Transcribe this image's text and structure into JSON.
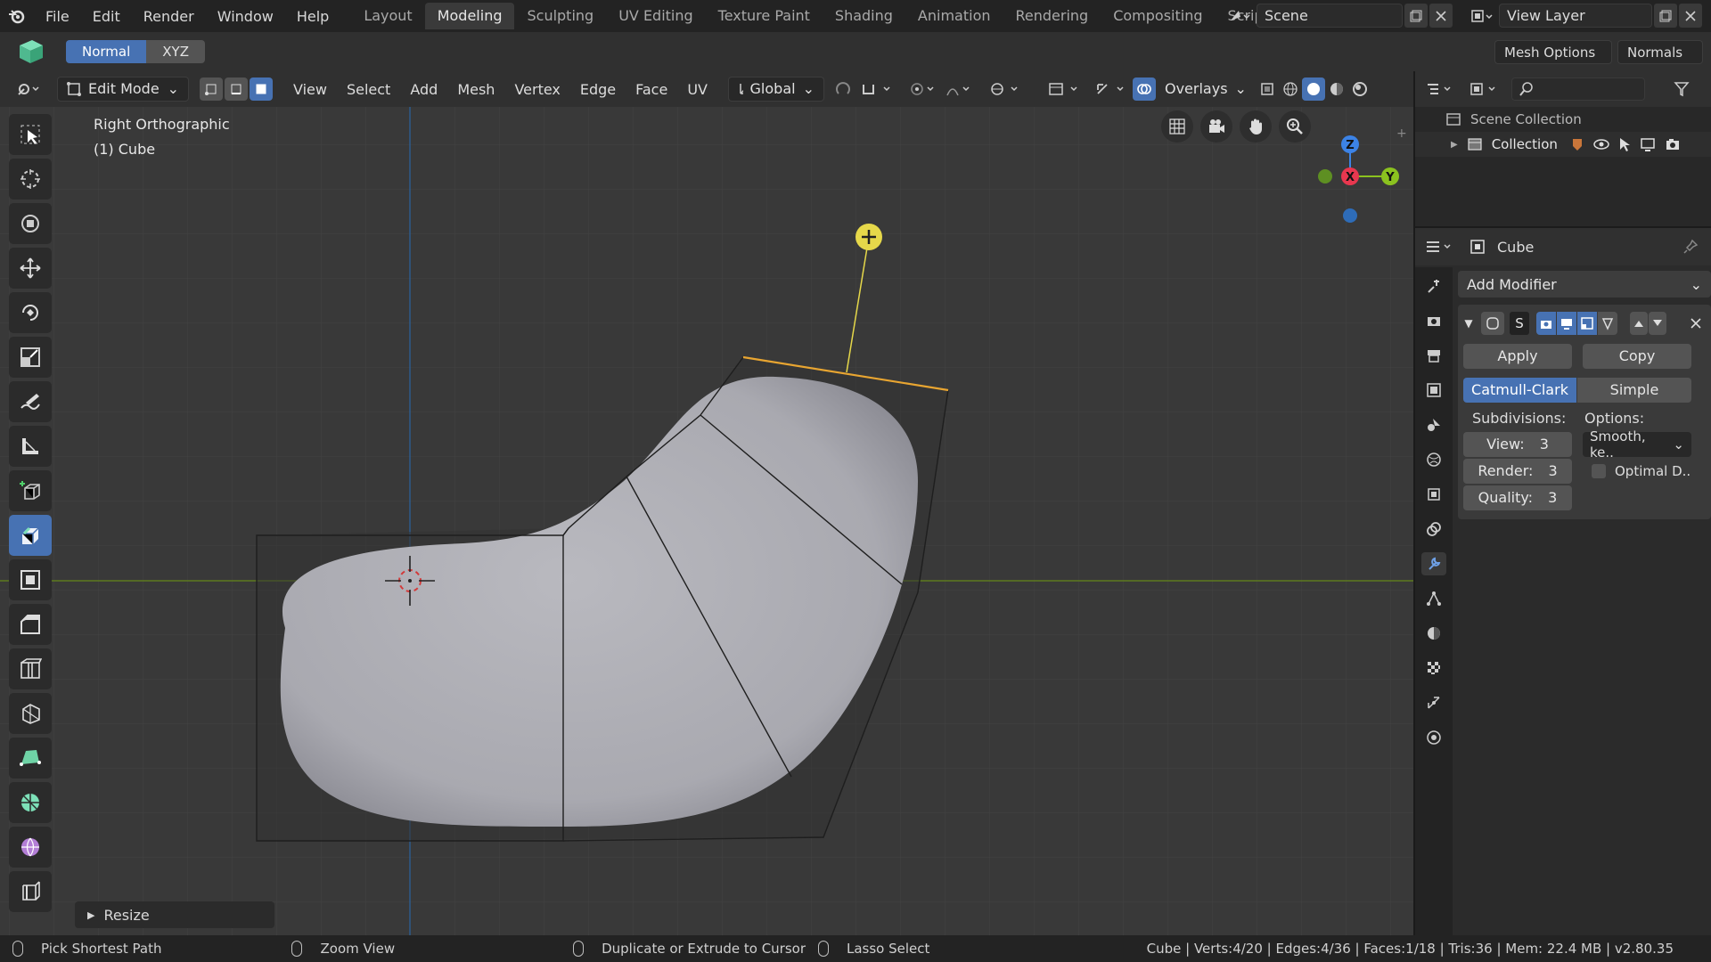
{
  "menu": [
    "File",
    "Edit",
    "Render",
    "Window",
    "Help"
  ],
  "workspace_tabs": [
    {
      "label": "Layout",
      "active": false
    },
    {
      "label": "Modeling",
      "active": true
    },
    {
      "label": "Sculpting",
      "active": false
    },
    {
      "label": "UV Editing",
      "active": false
    },
    {
      "label": "Texture Paint",
      "active": false
    },
    {
      "label": "Shading",
      "active": false
    },
    {
      "label": "Animation",
      "active": false
    },
    {
      "label": "Rendering",
      "active": false
    },
    {
      "label": "Compositing",
      "active": false
    },
    {
      "label": "Scripting",
      "active": false
    }
  ],
  "scene": {
    "name": "Scene"
  },
  "view_layer": {
    "name": "View Layer"
  },
  "toolbar2": {
    "normal": "Normal",
    "xyz": "XYZ",
    "mesh_options": "Mesh Options",
    "normals": "Normals"
  },
  "header": {
    "mode": "Edit Mode",
    "menus": [
      "View",
      "Select",
      "Add",
      "Mesh",
      "Vertex",
      "Edge",
      "Face",
      "UV"
    ],
    "orientation": "Global",
    "overlays": "Overlays"
  },
  "viewport": {
    "view_name": "Right Orthographic",
    "object": "(1) Cube",
    "resize_panel": "Resize"
  },
  "gizmo": {
    "z": "Z",
    "x": "X",
    "y": "Y"
  },
  "outliner": {
    "scene_collection": "Scene Collection",
    "collection": "Collection"
  },
  "properties": {
    "object": "Cube",
    "add_modifier": "Add Modifier",
    "modifier_name": "S",
    "apply": "Apply",
    "copy": "Copy",
    "catmull": "Catmull-Clark",
    "simple": "Simple",
    "subdivisions_label": "Subdivisions:",
    "options_label": "Options:",
    "view": "View:",
    "view_val": "3",
    "render": "Render:",
    "render_val": "3",
    "quality": "Quality:",
    "quality_val": "3",
    "smooth": "Smooth, ke..",
    "optimal": "Optimal D.."
  },
  "statusbar": {
    "left1": "Pick Shortest Path",
    "left2": "Zoom View",
    "left3": "Duplicate or Extrude to Cursor",
    "left4": "Lasso Select",
    "right": "Cube | Verts:4/20 | Edges:4/36 | Faces:1/18 | Tris:36 | Mem: 22.4 MB | v2.80.35"
  },
  "colors": {
    "accent": "#4772b3",
    "viewport": "#393939",
    "x_axis": "#e8374f",
    "y_axis": "#8bc21f",
    "z_axis": "#3c83e6",
    "selected_edge": "#e8a531"
  }
}
